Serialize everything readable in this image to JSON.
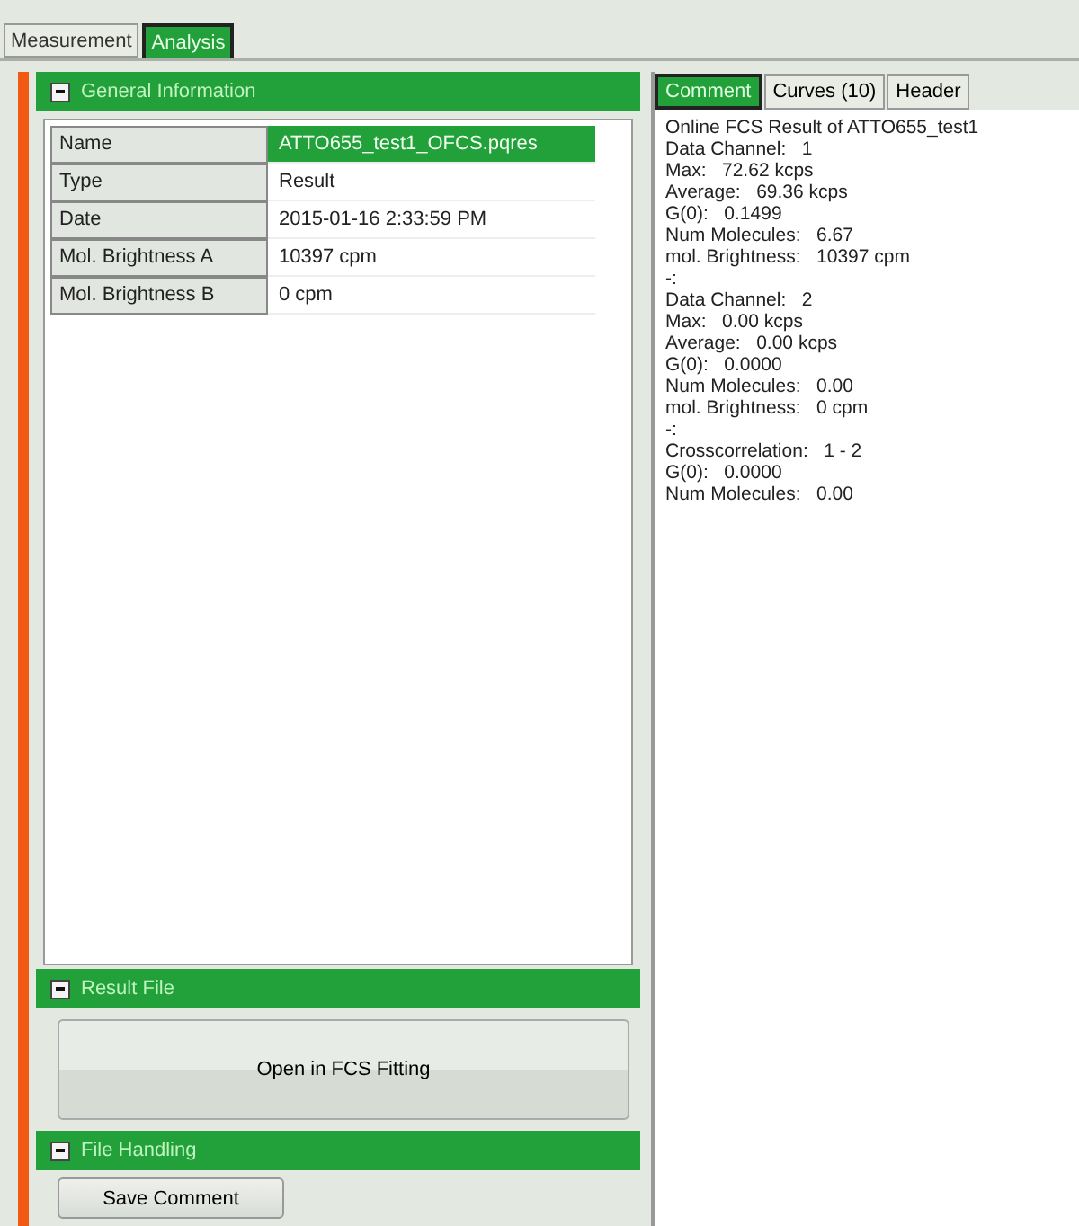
{
  "main_tabs": [
    {
      "label": "Measurement",
      "selected": false
    },
    {
      "label": "Analysis",
      "selected": true
    }
  ],
  "general_information": {
    "title": "General Information",
    "expanded": true,
    "rows": [
      {
        "label": "Name",
        "value": "ATTO655_test1_OFCS.pqres",
        "selected": true
      },
      {
        "label": "Type",
        "value": "Result",
        "selected": false
      },
      {
        "label": "Date",
        "value": "2015-01-16 2:33:59 PM",
        "selected": false
      },
      {
        "label": "Mol. Brightness A",
        "value": "10397 cpm",
        "selected": false
      },
      {
        "label": "Mol. Brightness B",
        "value": "0 cpm",
        "selected": false
      }
    ]
  },
  "result_file": {
    "title": "Result File",
    "expanded": true,
    "button": "Open in FCS Fitting"
  },
  "file_handling": {
    "title": "File Handling",
    "expanded": true,
    "button": "Save Comment"
  },
  "side_tabs": [
    {
      "label": "Comment",
      "selected": true
    },
    {
      "label": "Curves (10)",
      "selected": false
    },
    {
      "label": "Header",
      "selected": false
    }
  ],
  "comment_lines": [
    "Online FCS Result of ATTO655_test1",
    "Data Channel:   1",
    "Max:   72.62 kcps",
    "Average:   69.36 kcps",
    "G(0):   0.1499",
    "Num Molecules:   6.67",
    "mol. Brightness:   10397 cpm",
    "-:",
    "Data Channel:   2",
    "Max:   0.00 kcps",
    "Average:   0.00 kcps",
    "G(0):   0.0000",
    "Num Molecules:   0.00",
    "mol. Brightness:   0 cpm",
    "-:",
    "Crosscorrelation:   1 - 2",
    "G(0):   0.0000",
    "Num Molecules:   0.00"
  ]
}
